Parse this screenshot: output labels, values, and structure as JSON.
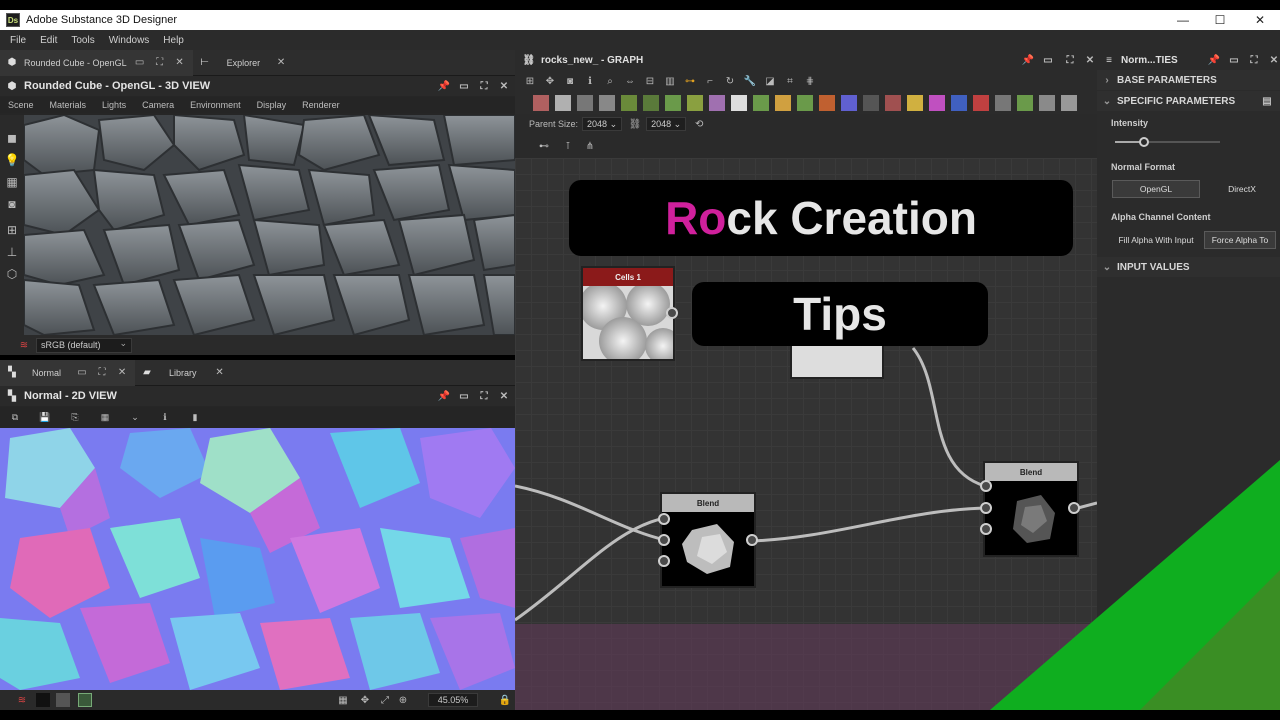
{
  "app": {
    "title": "Adobe Substance 3D Designer",
    "icon_text": "Ds"
  },
  "window_controls": {
    "minimize": "—",
    "maximize": "☐",
    "close": "✕"
  },
  "menu": [
    "File",
    "Edit",
    "Tools",
    "Windows",
    "Help"
  ],
  "left_top": {
    "tabs": [
      {
        "label": "Rounded Cube - OpenGL",
        "active": true
      },
      {
        "label": "Explorer",
        "active": false
      }
    ],
    "panel_title": "Rounded Cube - OpenGL - 3D VIEW",
    "submenu": [
      "Scene",
      "Materials",
      "Lights",
      "Camera",
      "Environment",
      "Display",
      "Renderer"
    ],
    "colorspace": "sRGB (default)"
  },
  "left_bottom": {
    "tabs": [
      {
        "label": "Normal",
        "active": true
      },
      {
        "label": "Library",
        "active": false
      }
    ],
    "panel_title": "Normal - 2D VIEW",
    "zoom": "45.05%"
  },
  "graph": {
    "title": "rocks_new_ - GRAPH",
    "parent_size_label": "Parent Size:",
    "parent_size_w": "2048",
    "parent_size_h": "2048",
    "nodes": [
      {
        "id": "cells",
        "label": "Cells 1",
        "header_color": "#8b1a1a"
      },
      {
        "id": "blend1",
        "label": "Blend",
        "header_color": "#b9b9b9"
      },
      {
        "id": "blend2",
        "label": "Blend",
        "header_color": "#b9b9b9"
      }
    ],
    "banner_title_accent": "Ro",
    "banner_title_rest": "ck Creation",
    "banner_sub": "Tips",
    "accent_color": "#d0209c"
  },
  "properties": {
    "title": "Norm...TIES",
    "sections": {
      "base": "BASE PARAMETERS",
      "specific": "SPECIFIC PARAMETERS",
      "input": "INPUT VALUES"
    },
    "intensity_label": "Intensity",
    "intensity_fraction": 0.28,
    "normal_format_label": "Normal Format",
    "normal_format_options": [
      "OpenGL",
      "DirectX"
    ],
    "normal_format_selected": "OpenGL",
    "alpha_label": "Alpha Channel Content",
    "alpha_options": [
      "Fill Alpha With Input",
      "Force Alpha To"
    ],
    "alpha_selected": "Force Alpha To"
  }
}
